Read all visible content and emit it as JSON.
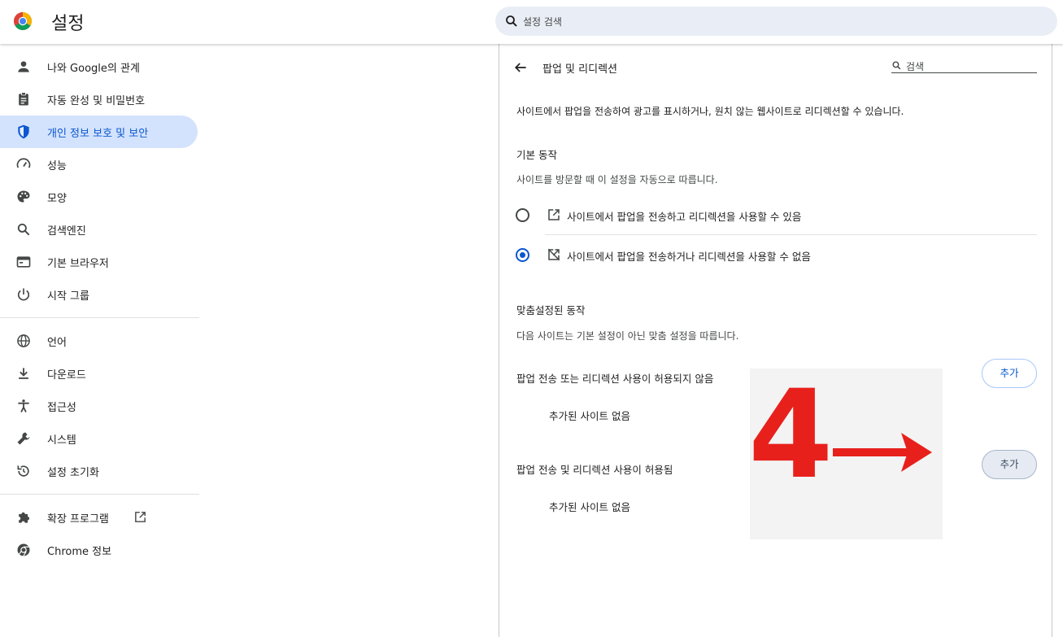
{
  "header": {
    "title": "설정",
    "search_placeholder": "설정 검색"
  },
  "sidebar": {
    "items": [
      {
        "label": "나와 Google의 관계",
        "icon": "person-icon"
      },
      {
        "label": "자동 완성 및 비밀번호",
        "icon": "clipboard-icon"
      },
      {
        "label": "개인 정보 보호 및 보안",
        "icon": "shield-icon",
        "active": true
      },
      {
        "label": "성능",
        "icon": "speedometer-icon"
      },
      {
        "label": "모양",
        "icon": "palette-icon"
      },
      {
        "label": "검색엔진",
        "icon": "search-icon"
      },
      {
        "label": "기본 브라우저",
        "icon": "browser-icon"
      },
      {
        "label": "시작 그룹",
        "icon": "power-icon"
      },
      {
        "label": "언어",
        "icon": "globe-icon"
      },
      {
        "label": "다운로드",
        "icon": "download-icon"
      },
      {
        "label": "접근성",
        "icon": "accessibility-icon"
      },
      {
        "label": "시스템",
        "icon": "wrench-icon"
      },
      {
        "label": "설정 초기화",
        "icon": "reset-icon"
      },
      {
        "label": "확장 프로그램",
        "icon": "puzzle-icon"
      },
      {
        "label": "Chrome 정보",
        "icon": "chrome-icon"
      }
    ]
  },
  "main": {
    "title": "팝업 및 리디렉션",
    "search_placeholder": "검색",
    "description": "사이트에서 팝업을 전송하여 광고를 표시하거나, 원치 않는 웹사이트로 리디렉션할 수 있습니다.",
    "default_behavior": {
      "title": "기본 동작",
      "subtitle": "사이트를 방문할 때 이 설정을 자동으로 따릅니다.",
      "options": [
        {
          "label": "사이트에서 팝업을 전송하고 리디렉션을 사용할 수 있음",
          "checked": false,
          "icon": "open-in-new-icon"
        },
        {
          "label": "사이트에서 팝업을 전송하거나 리디렉션을 사용할 수 없음",
          "checked": true,
          "icon": "popup-blocked-icon"
        }
      ]
    },
    "custom_behavior": {
      "title": "맞춤설정된 동작",
      "subtitle": "다음 사이트는 기본 설정이 아닌 맞춤 설정을 따릅니다.",
      "lists": [
        {
          "title": "팝업 전송 또는 리디렉션 사용이 허용되지 않음",
          "empty": "추가된 사이트 없음",
          "add_label": "추가"
        },
        {
          "title": "팝업 전송 및 리디렉션 사용이 허용됨",
          "empty": "추가된 사이트 없음",
          "add_label": "추가"
        }
      ]
    }
  },
  "annotation": {
    "number": "4"
  },
  "colors": {
    "accent": "#0b57d0",
    "active_bg": "#d3e3fd",
    "annotation_red": "#e8201c"
  }
}
